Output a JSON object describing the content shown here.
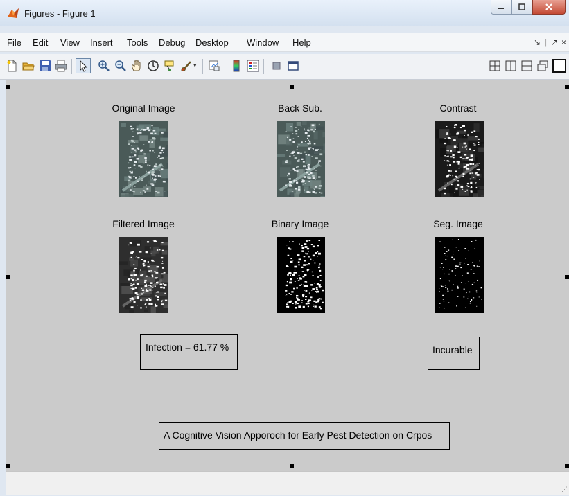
{
  "window": {
    "title": "Figures - Figure 1",
    "controls": [
      "minimize",
      "maximize",
      "close"
    ]
  },
  "menu": [
    "File",
    "Edit",
    "View",
    "Insert",
    "Tools",
    "Debug",
    "Desktop",
    "Window",
    "Help"
  ],
  "dock_controls": [
    "↘",
    "↗",
    "×"
  ],
  "toolbar_icons": [
    "new-figure-icon",
    "open-file-icon",
    "save-icon",
    "print-icon",
    "pointer-icon",
    "zoom-in-icon",
    "zoom-out-icon",
    "pan-icon",
    "rotate-3d-icon",
    "data-cursor-icon",
    "brush-icon",
    "link-plot-icon",
    "colorbar-icon",
    "legend-icon",
    "hide-plot-tools-icon",
    "show-plot-tools-icon"
  ],
  "layout_icons": [
    "tile-icon",
    "left-right-icon",
    "top-bottom-icon",
    "float-icon",
    "maximize-icon"
  ],
  "figure": {
    "panels": [
      {
        "title": "Original Image",
        "style": "color"
      },
      {
        "title": "Back Sub.",
        "style": "color"
      },
      {
        "title": "Contrast",
        "style": "dark"
      },
      {
        "title": "Filtered Image",
        "style": "gray"
      },
      {
        "title": "Binary Image",
        "style": "binary"
      },
      {
        "title": "Seg. Image",
        "style": "sparse"
      }
    ],
    "infection_text": "Infection = 61.77 %",
    "status_text": "Incurable",
    "caption": "A Cognitive Vision Apporoch for Early Pest Detection on Crpos"
  },
  "colors": {
    "figure_bg": "#cbcbcb",
    "titlebar": "#d3e0ef",
    "close_button": "#c44a34"
  }
}
